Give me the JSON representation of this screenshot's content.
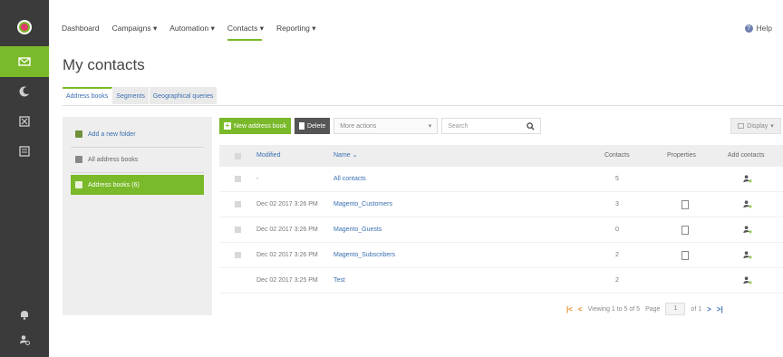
{
  "nav": {
    "items": [
      "Dashboard",
      "Campaigns ▾",
      "Automation ▾",
      "Contacts ▾",
      "Reporting ▾"
    ],
    "help": "Help"
  },
  "page": {
    "title": "My contacts"
  },
  "subtabs": [
    "Address books",
    "Segments",
    "Geographical queries"
  ],
  "folders": {
    "add_folder": "Add a new folder",
    "all_books": "All address books",
    "current": "Address books (6)"
  },
  "toolbar": {
    "new_book": "New address book",
    "delete": "Delete",
    "more_actions": "More actions",
    "search_placeholder": "Search",
    "display": "Display"
  },
  "table": {
    "headers": {
      "modified": "Modified",
      "name": "Name ⌄",
      "contacts": "Contacts",
      "properties": "Properties",
      "add_contacts": "Add contacts"
    },
    "rows": [
      {
        "modified": "-",
        "name": "All contacts",
        "contacts": "5",
        "has_properties": false,
        "has_checkbox": true
      },
      {
        "modified": "Dec 02 2017 3:26 PM",
        "name": "Magento_Customers",
        "contacts": "3",
        "has_properties": true,
        "has_checkbox": true
      },
      {
        "modified": "Dec 02 2017 3:26 PM",
        "name": "Magento_Guests",
        "contacts": "0",
        "has_properties": true,
        "has_checkbox": true
      },
      {
        "modified": "Dec 02 2017 3:26 PM",
        "name": "Magento_Subscribers",
        "contacts": "2",
        "has_properties": true,
        "has_checkbox": true
      },
      {
        "modified": "Dec 02 2017 3:25 PM",
        "name": "Test",
        "contacts": "2",
        "has_properties": false,
        "has_checkbox": false
      }
    ]
  },
  "pager": {
    "viewing": "Viewing 1 to 5 of 5",
    "page_label": "Page",
    "page_value": "1",
    "of": "of 1"
  },
  "colors": {
    "accent": "#7ab929",
    "rail": "#3b3b3b",
    "link": "#3a6fb0"
  }
}
